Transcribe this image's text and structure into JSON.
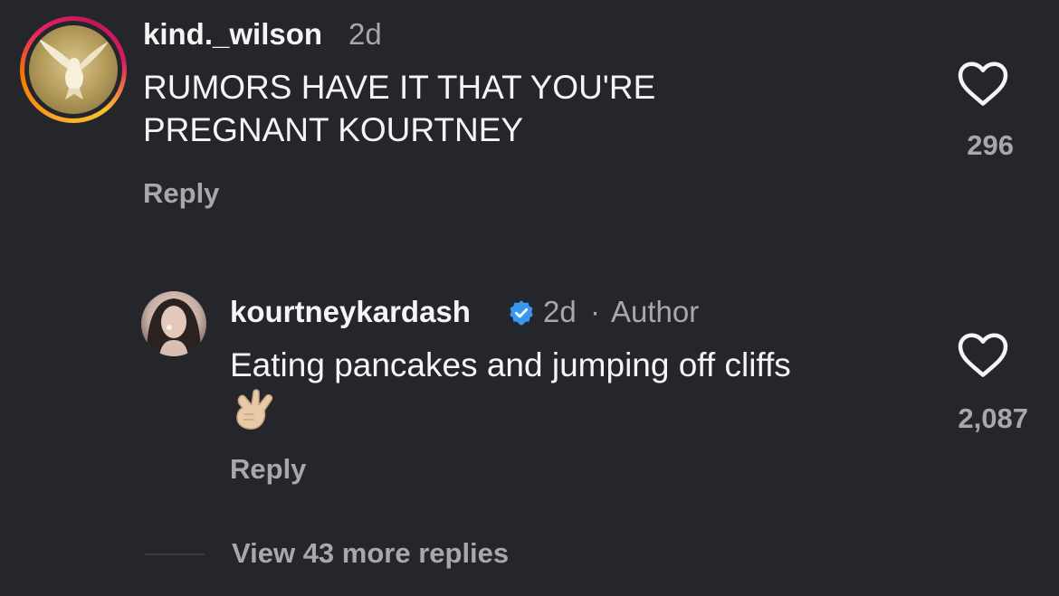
{
  "comments": [
    {
      "username": "kind._wilson",
      "time": "2d",
      "text_line1": "RUMORS HAVE IT THAT YOU'RE",
      "text_line2": "PREGNANT KOURTNEY",
      "like_count": "296",
      "reply_label": "Reply",
      "avatar_icon": "dove-avatar",
      "has_story_ring": true
    },
    {
      "username": "kourtneykardash",
      "verified": true,
      "time": "2d",
      "separator": "·",
      "author_label": "Author",
      "text_line1": "Eating pancakes and jumping off cliffs",
      "emoji_icon": "call-me-hand-emoji",
      "like_count": "2,087",
      "reply_label": "Reply",
      "avatar_icon": "profile-photo-avatar"
    }
  ],
  "view_more_label": "View 43 more replies",
  "colors": {
    "background": "#25262b",
    "primary_text": "#f5f5f5",
    "secondary_text": "#a6a8ae",
    "verified_badge": "#3897f0"
  }
}
